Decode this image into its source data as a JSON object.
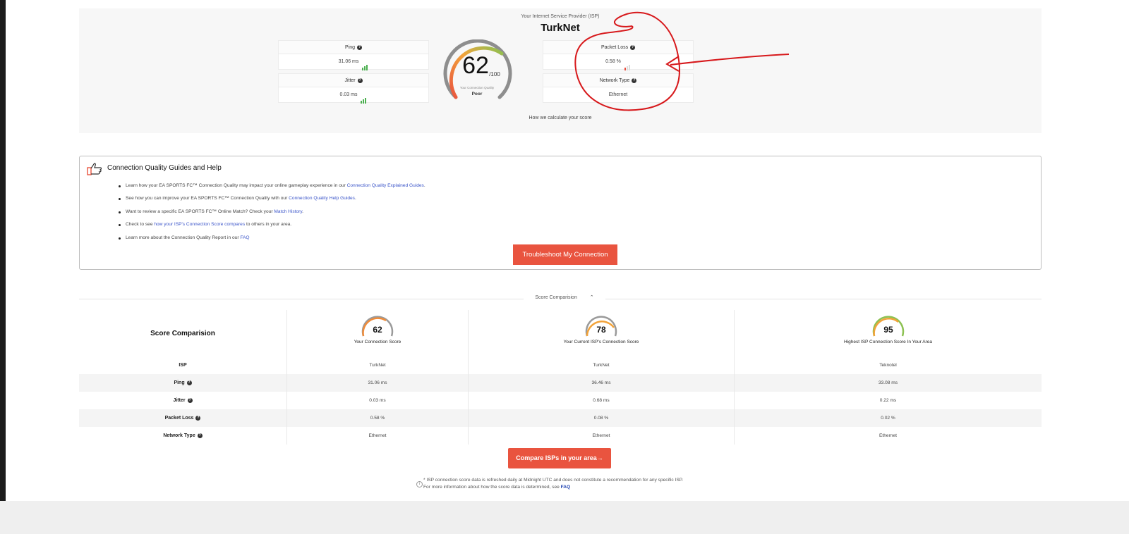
{
  "top": {
    "isp_label": "Your Internet Service Provider (ISP)",
    "isp_name": "TurkNet",
    "ping": {
      "title": "Ping",
      "value": "31.06 ms"
    },
    "jitter": {
      "title": "Jitter",
      "value": "0.03 ms"
    },
    "packet_loss": {
      "title": "Packet Loss",
      "value": "0.58 %"
    },
    "network_type": {
      "title": "Network Type",
      "value": "Ethernet"
    },
    "score": {
      "value": "62",
      "max": "/100",
      "caption": "Your Connection Quality",
      "rating": "Poor"
    },
    "calc_link": "How we calculate your score"
  },
  "guides": {
    "title": "Connection Quality Guides and Help",
    "items": [
      {
        "pre": "Learn how your EA SPORTS FC™ Connection Quality may impact your online gameplay experience in our ",
        "link": "Connection Quality Explained Guides",
        "post": "."
      },
      {
        "pre": "See how you can improve your EA SPORTS FC™ Connection Quality with our ",
        "link": "Connection Quality Help Guides",
        "post": "."
      },
      {
        "pre": "Want to review a specific EA SPORTS FC™ Online Match? Check your ",
        "link": "Match History",
        "post": "."
      },
      {
        "pre": "Check to see ",
        "link": "how your ISP's Connection Score compares",
        "post": " to others in your area."
      },
      {
        "pre": "Learn more about the Connection Quality Report in our ",
        "link": "FAQ",
        "post": ""
      }
    ],
    "button": "Troubleshoot My Connection"
  },
  "comparison": {
    "toggle": "Score Comparision",
    "title": "Score Comparision",
    "columns": [
      {
        "score": "62",
        "label": "Your Connection Score"
      },
      {
        "score": "78",
        "label": "Your Current ISP's Connection Score"
      },
      {
        "score": "95",
        "label": "Highest ISP Connection Score In Your Area"
      }
    ],
    "rows": [
      {
        "label": "ISP",
        "values": [
          "TurkNet",
          "TurkNet",
          "Teknotel"
        ]
      },
      {
        "label": "Ping",
        "values": [
          "31.06 ms",
          "36.46 ms",
          "33.08 ms"
        ]
      },
      {
        "label": "Jitter",
        "values": [
          "0.03 ms",
          "0.68 ms",
          "0.22 ms"
        ]
      },
      {
        "label": "Packet Loss",
        "values": [
          "0.58 %",
          "0.08 %",
          "0.02 %"
        ]
      },
      {
        "label": "Network Type",
        "values": [
          "Ethernet",
          "Ethernet",
          "Ethernet"
        ]
      }
    ],
    "compare_button": "Compare ISPs in your area→",
    "footnote_line1": "* ISP connection score data is refreshed daily at Midnight UTC and does not constitute a recommendation for any specific ISP.",
    "footnote_line2": "For more information about how the score data is determined, see ",
    "footnote_link": "FAQ"
  },
  "colors": {
    "accent": "#e9543f",
    "good": "#4cb050",
    "link": "#3a54c9"
  }
}
